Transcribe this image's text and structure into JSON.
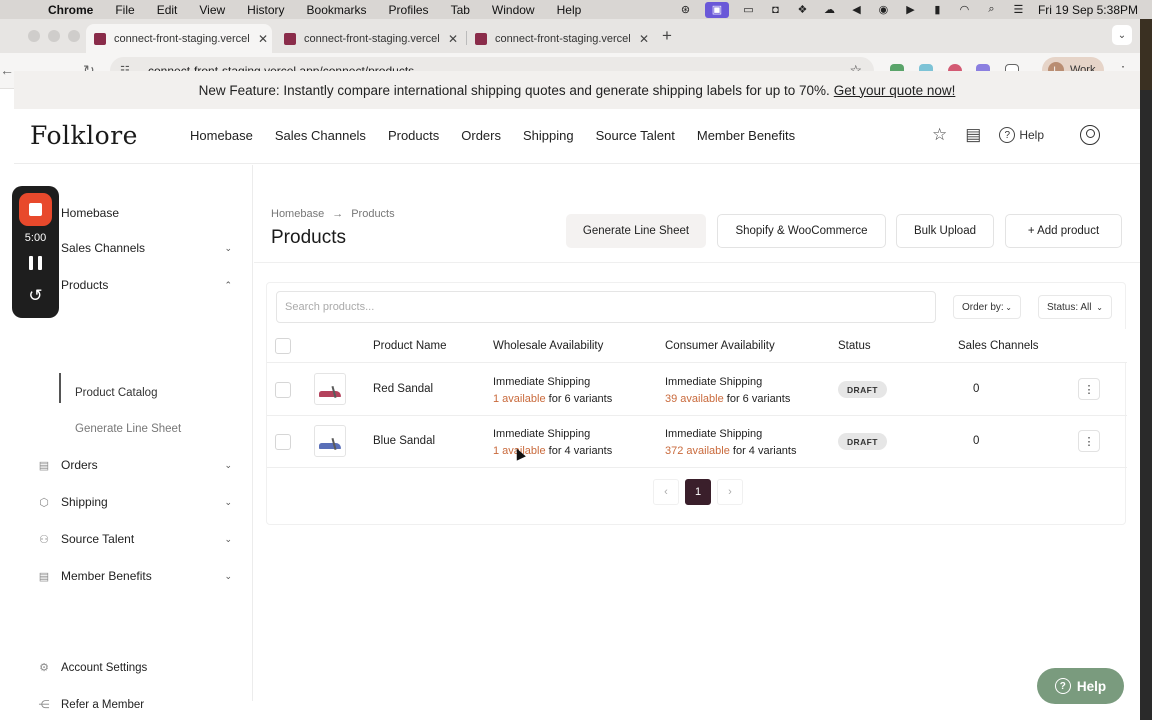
{
  "menubar": {
    "app": "Chrome",
    "items": [
      "File",
      "Edit",
      "View",
      "History",
      "Bookmarks",
      "Profiles",
      "Tab",
      "Window",
      "Help"
    ],
    "clock": "Fri 19 Sep  5:38PM"
  },
  "browser": {
    "tabs": [
      {
        "title": "connect-front-staging.vercel"
      },
      {
        "title": "connect-front-staging.vercel"
      },
      {
        "title": "connect-front-staging.vercel"
      }
    ],
    "url": "connect-front-staging.vercel.app/connect/products",
    "profile_label": "Work",
    "profile_initial": "L"
  },
  "banner": {
    "text": "New Feature: Instantly compare international shipping quotes and generate shipping labels for up to 70%.",
    "link": "Get your quote now!"
  },
  "topnav": {
    "logo": "Folklore",
    "links": [
      "Homebase",
      "Sales Channels",
      "Products",
      "Orders",
      "Shipping",
      "Source Talent",
      "Member Benefits"
    ],
    "help_label": "Help"
  },
  "recorder": {
    "time": "5:00"
  },
  "sidebar": {
    "items": [
      {
        "label": "Homebase"
      },
      {
        "label": "Sales Channels"
      },
      {
        "label": "Products"
      },
      {
        "label": "Orders"
      },
      {
        "label": "Shipping"
      },
      {
        "label": "Source Talent"
      },
      {
        "label": "Member Benefits"
      }
    ],
    "sub_items": [
      {
        "label": "Product Catalog"
      },
      {
        "label": "Generate Line Sheet"
      }
    ],
    "bottom": [
      {
        "label": "Refer a Member"
      },
      {
        "label": "Account Settings"
      }
    ]
  },
  "main": {
    "breadcrumb": [
      "Homebase",
      "→",
      "Products"
    ],
    "title": "Products",
    "buttons": {
      "line_sheet": "Generate Line Sheet",
      "shopify": "Shopify & WooCommerce",
      "bulk": "Bulk Upload",
      "add": "+ Add product"
    },
    "search_placeholder": "Search products...",
    "order_by": "Order by:",
    "status_filter": "Status: All",
    "columns": [
      "Product Name",
      "Wholesale Availability",
      "Consumer Availability",
      "Status",
      "Sales Channels"
    ],
    "rows": [
      {
        "name": "Red Sandal",
        "wholesale_line1": "Immediate Shipping",
        "wholesale_avail": "1 available",
        "wholesale_variants": " for 6 variants",
        "consumer_line1": "Immediate Shipping",
        "consumer_avail": "39 available",
        "consumer_variants": " for 6 variants",
        "status": "DRAFT",
        "channels": "0"
      },
      {
        "name": "Blue Sandal",
        "wholesale_line1": "Immediate Shipping",
        "wholesale_avail": "1 available",
        "wholesale_variants": " for 4 variants",
        "consumer_line1": "Immediate Shipping",
        "consumer_avail": "372 available",
        "consumer_variants": " for 4 variants",
        "status": "DRAFT",
        "channels": "0"
      }
    ],
    "pagination": {
      "prev": "‹",
      "current": "1",
      "next": "›"
    }
  },
  "help_fab": "Help",
  "colors": {
    "accent": "#3a1f2b",
    "available": "#c96a3c",
    "recorder_stop": "#e8492c",
    "help_fab": "#7a9b7e"
  }
}
